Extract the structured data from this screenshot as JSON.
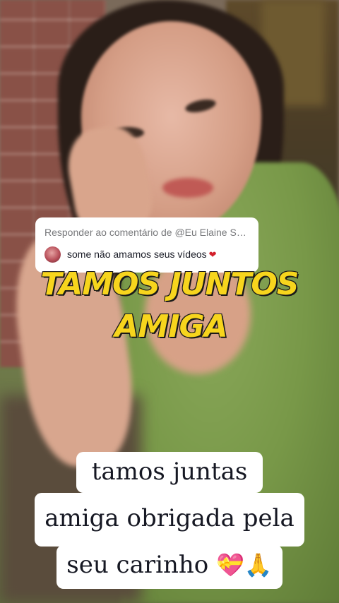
{
  "reply_card": {
    "header": "Responder ao comentário de @Eu Elaine Sou...",
    "comment_text": "some não amamos seus vídeos",
    "heart_emoji": "❤"
  },
  "headline": {
    "line1": "TAMOS JUNTOS",
    "line2": "AMIGA"
  },
  "caption": {
    "line1": "tamos juntas",
    "line2": "amiga obrigada pela",
    "line3_text": "seu carinho",
    "line3_emoji1": "💝",
    "line3_emoji2": "🙏"
  },
  "colors": {
    "headline_fill": "#f7d51d",
    "headline_stroke": "#1a1a1a",
    "caption_bg": "#ffffff",
    "caption_text": "#161823",
    "reply_header_text": "#77787b",
    "heart": "#d21f2b"
  }
}
